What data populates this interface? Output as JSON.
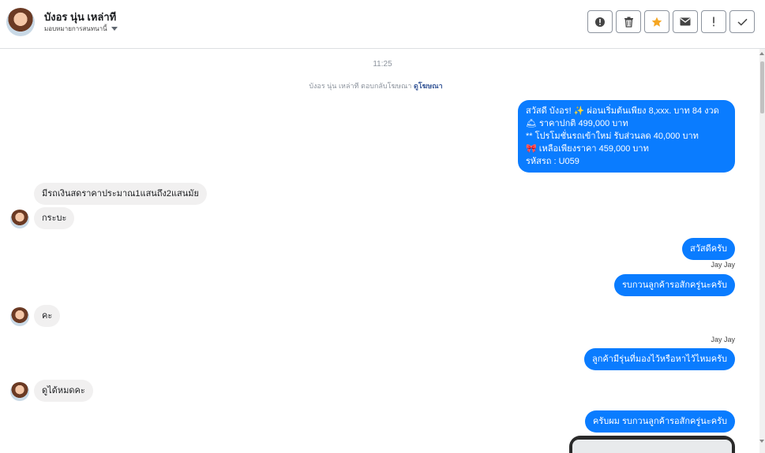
{
  "header": {
    "name": "บังอร นุ่น เหล่าที",
    "assign_label": "มอบหมายการสนทนานี้",
    "toolbar": [
      {
        "icon": "alert-circle-icon",
        "label": "spam"
      },
      {
        "icon": "trash-icon",
        "label": "delete"
      },
      {
        "icon": "star-icon",
        "label": "star"
      },
      {
        "icon": "mail-icon",
        "label": "mark unread"
      },
      {
        "icon": "exclamation-icon",
        "label": "follow up"
      },
      {
        "icon": "check-icon",
        "label": "done"
      }
    ]
  },
  "thread": {
    "timestamp": "11:25",
    "notice_text": "บังอร นุ่น เหล่าที ตอบกลับโฆษณา",
    "notice_link": "ดูโฆษณา",
    "ad_message": {
      "lines": [
        "สวัสดี บังอร! ✨  ผ่อนเริ่มต้นเพียง 8,xxx. บาท 84 งวด",
        "🛎  ราคาปกติ 499,000 บาท",
        "** โปรโมชั่นรถเข้าใหม่ รับส่วนลด 40,000 บาท",
        "🎀  เหลือเพียงราคา 459,000 บาท",
        "รหัสรถ : U059"
      ]
    },
    "messages": [
      {
        "id": "m1",
        "text": "มีรถเงินสดราคาประมาณ1แสนถึง2แสนมัย"
      },
      {
        "id": "m2",
        "text": "กระบะ"
      },
      {
        "id": "m3",
        "text": "สวัสดีครับ"
      },
      {
        "id": "m3s",
        "text": "Jay Jay"
      },
      {
        "id": "m4",
        "text": "รบกวนลูกค้ารอสักครู่นะครับ"
      },
      {
        "id": "m5",
        "text": "คะ"
      },
      {
        "id": "m6s",
        "text": "Jay Jay"
      },
      {
        "id": "m6",
        "text": "ลูกค้ามีรุ่นที่มองไว้หรือหาไว้ไหมครับ"
      },
      {
        "id": "m7",
        "text": "ดูได้หมดคะ"
      },
      {
        "id": "m8",
        "text": "ครับผม รบกวนลูกค้ารอสักครู่นะครับ"
      }
    ]
  },
  "colors": {
    "outgoing_bubble": "#0a7cff",
    "incoming_bubble": "#f1f0f0",
    "star_accent": "#f5a623"
  }
}
